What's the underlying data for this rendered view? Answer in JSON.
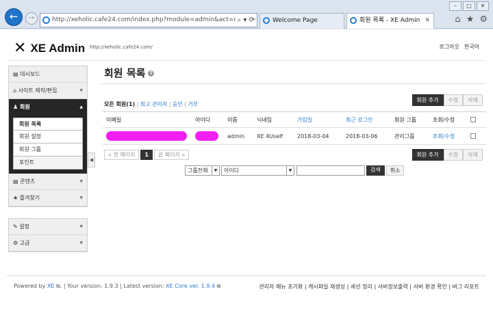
{
  "browser": {
    "url": "http://xeholic.cafe24.com/index.php?module=admin&act=dispMe",
    "tabs": [
      {
        "label": "Welcome Page"
      },
      {
        "label": "회원 목록 - XE Admin"
      }
    ],
    "back_glyph": "←",
    "forward_glyph": "→"
  },
  "header": {
    "logo_mark": "✕",
    "logo_text": "XE Admin",
    "site_url": "http://xeholic.cafe24.com/",
    "logout": "로그아웃",
    "language": "한국어"
  },
  "sidebar": {
    "items": [
      {
        "label": "대시보드",
        "icon": "dashboard-icon"
      },
      {
        "label": "사이트 제작/편집",
        "icon": "home-icon"
      },
      {
        "label": "회원",
        "icon": "user-icon"
      },
      {
        "label": "콘텐츠",
        "icon": "list-icon"
      },
      {
        "label": "즐겨찾기",
        "icon": "star-icon"
      },
      {
        "label": "설정",
        "icon": "wrench-icon"
      },
      {
        "label": "고급",
        "icon": "gear-icon"
      }
    ],
    "member_sub": [
      "회원 목록",
      "회원 설정",
      "회원 그룹",
      "포인트"
    ]
  },
  "main": {
    "title": "회원 목록",
    "filters": {
      "all": "모든 회원(1)",
      "admin": "최고 관리자",
      "approved": "승인",
      "denied": "거부"
    },
    "buttons": {
      "add": "회원 추가",
      "edit": "수정",
      "delete": "삭제"
    },
    "table": {
      "headers": [
        "이메일",
        "아이디",
        "이름",
        "닉네임",
        "가입일",
        "최근 로그인",
        "회원 그룹",
        "조회/수정"
      ],
      "rows": [
        {
          "name": "admin",
          "nickname": "XE 4Uself",
          "joined": "2018-03-04",
          "last_login": "2018-03-06",
          "group": "관리그룹",
          "action": "조회/수정"
        }
      ]
    },
    "pager": {
      "first": "« 첫 페이지",
      "current": "1",
      "last": "끝 페이지 »"
    },
    "search": {
      "group_select": "그룹전체",
      "field_select": "아이디",
      "submit": "검색",
      "cancel": "취소"
    }
  },
  "footer": {
    "powered": "Powered by",
    "xe": "XE",
    "your_version_label": "| Your version: 1.9.3",
    "latest_label": "| Latest version:",
    "latest_link": "XE Core ver. 1.9.4",
    "links": "관리자 메뉴 초기화 | 캐시파일 재생성 | 세션 정리 | 서버정보출력 | 서버 환경 확인 | 버그 리포트"
  },
  "colors": {
    "accent": "#2b7ad0",
    "highlight": "#f01ff0",
    "dark": "#262626"
  }
}
